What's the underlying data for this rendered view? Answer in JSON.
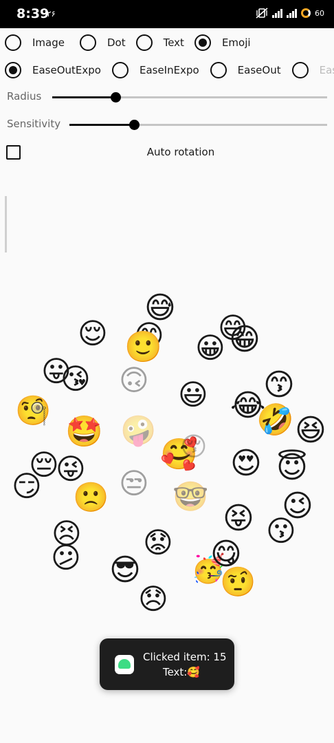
{
  "status_bar": {
    "time": "8:39",
    "date": "۲۶",
    "battery": "60"
  },
  "shape_options": [
    {
      "label": "Image",
      "selected": false
    },
    {
      "label": "Dot",
      "selected": false
    },
    {
      "label": "Text",
      "selected": false
    },
    {
      "label": "Emoji",
      "selected": true
    }
  ],
  "easing_options": [
    {
      "label": "EaseOutExpo",
      "selected": true
    },
    {
      "label": "EaseInExpo",
      "selected": false
    },
    {
      "label": "EaseOut",
      "selected": false
    },
    {
      "label": "Ease",
      "selected": false
    }
  ],
  "radius": {
    "label": "Radius",
    "value": 0.23
  },
  "sensitivity": {
    "label": "Sensitivity",
    "value": 0.25
  },
  "auto_rotation": {
    "label": "Auto rotation",
    "checked": false
  },
  "cloud_emojis": [
    {
      "char": "😅",
      "alpha": 1.0
    },
    {
      "char": "😌",
      "alpha": 1.0
    },
    {
      "char": "😊",
      "alpha": 1.0
    },
    {
      "char": "🙂",
      "alpha": 1.0
    },
    {
      "char": "😄",
      "alpha": 1.0
    },
    {
      "char": "😁",
      "alpha": 1.0
    },
    {
      "char": "😀",
      "alpha": 1.0
    },
    {
      "char": "😙",
      "alpha": 1.0
    },
    {
      "char": "😛",
      "alpha": 1.0
    },
    {
      "char": "😘",
      "alpha": 1.0
    },
    {
      "char": "🙃",
      "alpha": 0.4
    },
    {
      "char": "😃",
      "alpha": 1.0
    },
    {
      "char": "🧐",
      "alpha": 1.0
    },
    {
      "char": "😂",
      "alpha": 1.0
    },
    {
      "char": "🤣",
      "alpha": 1.0
    },
    {
      "char": "😆",
      "alpha": 1.0
    },
    {
      "char": "🤩",
      "alpha": 1.0
    },
    {
      "char": "🤪",
      "alpha": 0.4
    },
    {
      "char": "🥰",
      "alpha": 1.0
    },
    {
      "char": "😚",
      "alpha": 0.3
    },
    {
      "char": "😍",
      "alpha": 1.0
    },
    {
      "char": "😇",
      "alpha": 1.0
    },
    {
      "char": "😔",
      "alpha": 1.0
    },
    {
      "char": "😜",
      "alpha": 1.0
    },
    {
      "char": "😏",
      "alpha": 1.0
    },
    {
      "char": "🙁",
      "alpha": 1.0
    },
    {
      "char": "😒",
      "alpha": 0.4
    },
    {
      "char": "🤓",
      "alpha": 0.5
    },
    {
      "char": "😉",
      "alpha": 1.0
    },
    {
      "char": "😝",
      "alpha": 1.0
    },
    {
      "char": "😗",
      "alpha": 1.0
    },
    {
      "char": "😣",
      "alpha": 1.0
    },
    {
      "char": "😕",
      "alpha": 1.0
    },
    {
      "char": "😟",
      "alpha": 1.0
    },
    {
      "char": "😎",
      "alpha": 1.0
    },
    {
      "char": "🥳",
      "alpha": 1.0
    },
    {
      "char": "😋",
      "alpha": 1.0
    },
    {
      "char": "🤨",
      "alpha": 1.0
    },
    {
      "char": "😞",
      "alpha": 1.0
    }
  ],
  "toast": {
    "line1": "Clicked item: 15",
    "line2": "Text:🥰"
  },
  "colors": {
    "toast_background": "#1e1e1e",
    "slider_active": "#111111",
    "slider_inactive": "#c5c5c5"
  }
}
